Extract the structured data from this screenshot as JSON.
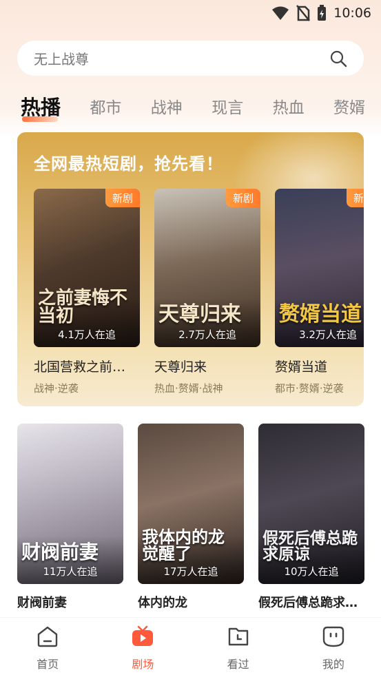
{
  "status": {
    "time": "10:06"
  },
  "search": {
    "placeholder": "无上战尊"
  },
  "tabs": [
    {
      "label": "热播",
      "active": true
    },
    {
      "label": "都市"
    },
    {
      "label": "战神"
    },
    {
      "label": "现言"
    },
    {
      "label": "热血"
    },
    {
      "label": "赘婿"
    }
  ],
  "featured": {
    "title": "全网最热短剧，抢先看！",
    "items": [
      {
        "badge": "新剧",
        "poster_text": "之前妻悔不当初",
        "watchers": "4.1万人在追",
        "title": "北国营救之前妻悔不当初",
        "tags": "战神·逆袭"
      },
      {
        "badge": "新剧",
        "poster_text": "天尊归来",
        "watchers": "2.7万人在追",
        "title": "天尊归来",
        "tags": "热血·赘婿·战神"
      },
      {
        "badge": "新剧",
        "poster_text": "赘婿当道",
        "watchers": "3.2万人在追",
        "title": "赘婿当道",
        "tags": "都市·赘婿·逆袭"
      }
    ]
  },
  "grid": [
    {
      "poster_text": "财阀前妻",
      "watchers": "11万人在追",
      "title": "财阀前妻",
      "tags": ""
    },
    {
      "poster_text": "我体内的龙觉醒了",
      "watchers": "17万人在追",
      "title": "体内的龙",
      "tags": ""
    },
    {
      "poster_text": "假死后傅总跪求原谅",
      "watchers": "10万人在追",
      "title": "假死后傅总跪求原谅",
      "tags": ""
    }
  ],
  "nav": [
    {
      "label": "首页",
      "icon": "home-icon"
    },
    {
      "label": "剧场",
      "icon": "theater-icon",
      "active": true
    },
    {
      "label": "看过",
      "icon": "history-icon"
    },
    {
      "label": "我的",
      "icon": "profile-icon"
    }
  ],
  "colors": {
    "accent": "#ff5a3c",
    "featured_gold": "#d9a94a"
  }
}
